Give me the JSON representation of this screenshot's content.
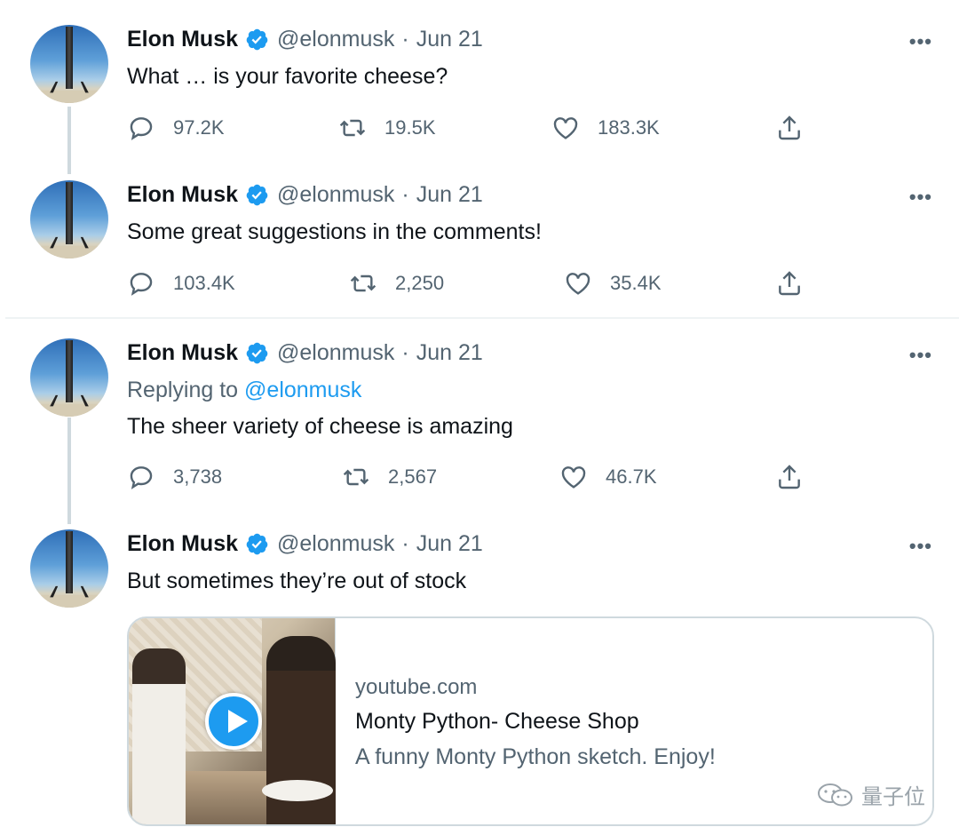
{
  "tweets": [
    {
      "name": "Elon Musk",
      "handle": "@elonmusk",
      "separator": "·",
      "date": "Jun 21",
      "text": "What … is your favorite cheese?",
      "replies": "97.2K",
      "retweets": "19.5K",
      "likes": "183.3K"
    },
    {
      "name": "Elon Musk",
      "handle": "@elonmusk",
      "separator": "·",
      "date": "Jun 21",
      "text": "Some great suggestions in the comments!",
      "replies": "103.4K",
      "retweets": "2,250",
      "likes": "35.4K"
    },
    {
      "name": "Elon Musk",
      "handle": "@elonmusk",
      "separator": "·",
      "date": "Jun 21",
      "replying_prefix": "Replying to",
      "replying_to": "@elonmusk",
      "text": "The sheer variety of cheese is amazing",
      "replies": "3,738",
      "retweets": "2,567",
      "likes": "46.7K"
    },
    {
      "name": "Elon Musk",
      "handle": "@elonmusk",
      "separator": "·",
      "date": "Jun 21",
      "text": "But sometimes they’re out of stock"
    }
  ],
  "more_label": "•••",
  "card": {
    "domain": "youtube.com",
    "title": "Monty Python- Cheese Shop",
    "description": "A funny Monty Python sketch. Enjoy!"
  },
  "watermark": {
    "text": "量子位"
  },
  "colors": {
    "accent": "#1d9bf0",
    "text_primary": "#0f1419",
    "text_secondary": "#536471",
    "border": "#cfd9de"
  },
  "icons": {
    "reply": "reply-icon",
    "retweet": "retweet-icon",
    "like": "heart-icon",
    "share": "share-icon",
    "verified": "verified-badge-icon",
    "more": "more-icon",
    "play": "play-icon"
  }
}
